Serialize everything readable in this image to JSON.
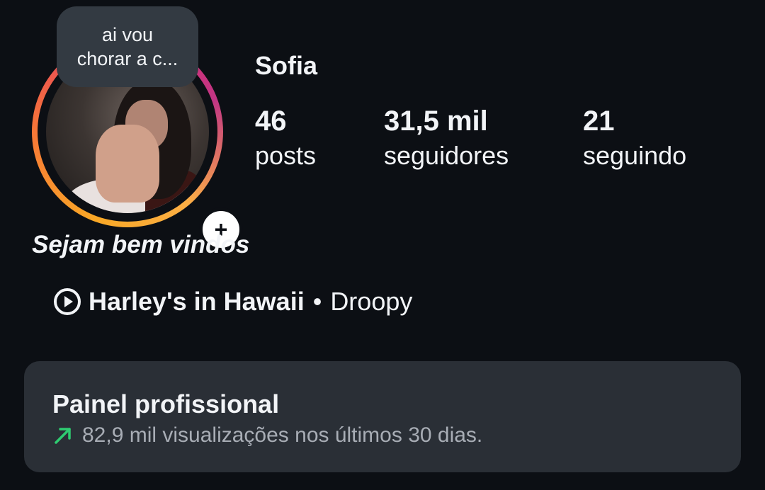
{
  "note": {
    "line1": "ai vou",
    "line2": "chorar a c..."
  },
  "profile": {
    "username": "Sofia",
    "bio": "Sejam bem vindos"
  },
  "stats": [
    {
      "value": "46",
      "label": "posts"
    },
    {
      "value": "31,5 mil",
      "label": "seguidores"
    },
    {
      "value": "21",
      "label": "seguindo"
    }
  ],
  "music": {
    "icon": "play-circle-icon",
    "song": "Harley's in Hawaii",
    "separator": "•",
    "artist": "Droopy"
  },
  "dashboard": {
    "title": "Painel profissional",
    "trend_icon": "trend-up-arrow-icon",
    "trend_color": "#2ecc71",
    "summary": "82,9 mil visualizações nos últimos 30 dias."
  },
  "colors": {
    "background": "#0c0f14",
    "panel": "#2a2f36",
    "note_bubble": "#333a42"
  }
}
